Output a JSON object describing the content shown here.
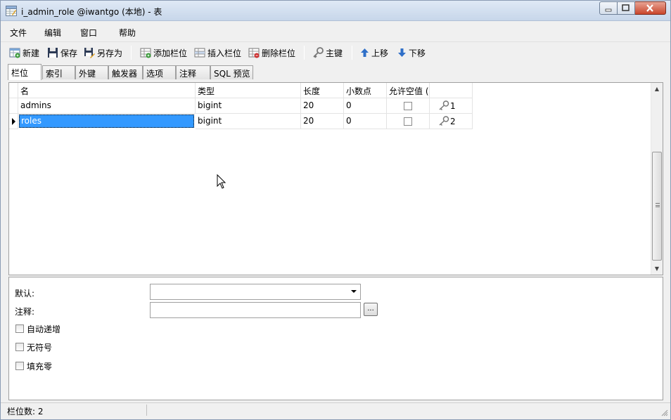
{
  "window": {
    "title": "i_admin_role @iwantgo (本地) - 表"
  },
  "menu": [
    "文件",
    "编辑",
    "窗口",
    "帮助"
  ],
  "toolbar": {
    "new": "新建",
    "save": "保存",
    "save_as": "另存为",
    "add_field": "添加栏位",
    "insert_field": "插入栏位",
    "delete_field": "删除栏位",
    "primary_key": "主键",
    "move_up": "上移",
    "move_down": "下移"
  },
  "tabs": [
    "栏位",
    "索引",
    "外键",
    "触发器",
    "选项",
    "注释",
    "SQL 预览"
  ],
  "grid": {
    "headers": [
      "名",
      "类型",
      "长度",
      "小数点",
      "允许空值 (",
      ""
    ],
    "rows": [
      {
        "name": "admins",
        "type": "bigint",
        "length": "20",
        "decimals": "0",
        "nullable": false,
        "key": "1"
      },
      {
        "name": "roles",
        "type": "bigint",
        "length": "20",
        "decimals": "0",
        "nullable": false,
        "key": "2"
      }
    ]
  },
  "properties": {
    "default_label": "默认:",
    "default_value": "",
    "comment_label": "注释:",
    "comment_value": "",
    "ellipsis": "...",
    "auto_increment": "自动递增",
    "unsigned": "无符号",
    "zerofill": "填充零"
  },
  "status": {
    "field_count": "栏位数: 2"
  }
}
